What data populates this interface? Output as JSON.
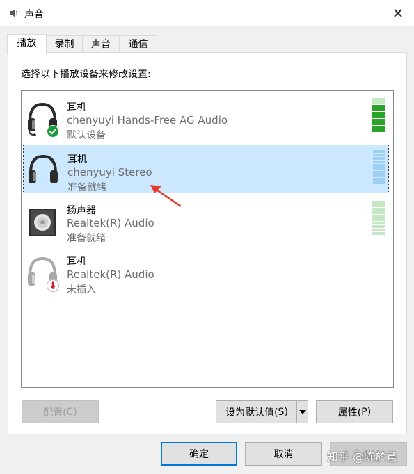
{
  "window": {
    "title": "声音",
    "close_glyph": "✕"
  },
  "tabs": [
    {
      "label": "播放",
      "active": true
    },
    {
      "label": "录制",
      "active": false
    },
    {
      "label": "声音",
      "active": false
    },
    {
      "label": "通信",
      "active": false
    }
  ],
  "instruction": "选择以下播放设备来修改设置:",
  "devices": [
    {
      "name": "耳机",
      "description": "chenyuyi Hands-Free AG Audio",
      "status": "默认设备",
      "icon": "headphones-icon",
      "badge": "default-check-badge",
      "selected": false,
      "level": 0.8
    },
    {
      "name": "耳机",
      "description": "chenyuyi Stereo",
      "status": "准备就绪",
      "icon": "headphones-icon",
      "badge": "",
      "selected": true,
      "level": 0
    },
    {
      "name": "扬声器",
      "description": "Realtek(R) Audio",
      "status": "准备就绪",
      "icon": "speaker-icon",
      "badge": "",
      "selected": false,
      "level": 0
    },
    {
      "name": "耳机",
      "description": "Realtek(R) Audio",
      "status": "未插入",
      "icon": "headphones-icon",
      "badge": "unplugged-badge",
      "selected": false,
      "level": null
    }
  ],
  "buttons": {
    "configure": {
      "label": "配置(",
      "key": "C",
      "suffix": ")"
    },
    "set_default": {
      "label": "设为默认值(",
      "key": "S",
      "suffix": ")"
    },
    "properties": {
      "label": "属性(",
      "key": "P",
      "suffix": ")"
    },
    "ok": "确定",
    "cancel": "取消",
    "apply": "应用(A)"
  },
  "watermark": "知乎 @陈於意",
  "colors": {
    "accent": "#0078d7",
    "selection": "#cce8ff",
    "meter_active": "#29a329",
    "meter_idle": "#c4e8c4",
    "meter_selected_idle": "#9ccff2",
    "arrow": "#e8382e"
  }
}
